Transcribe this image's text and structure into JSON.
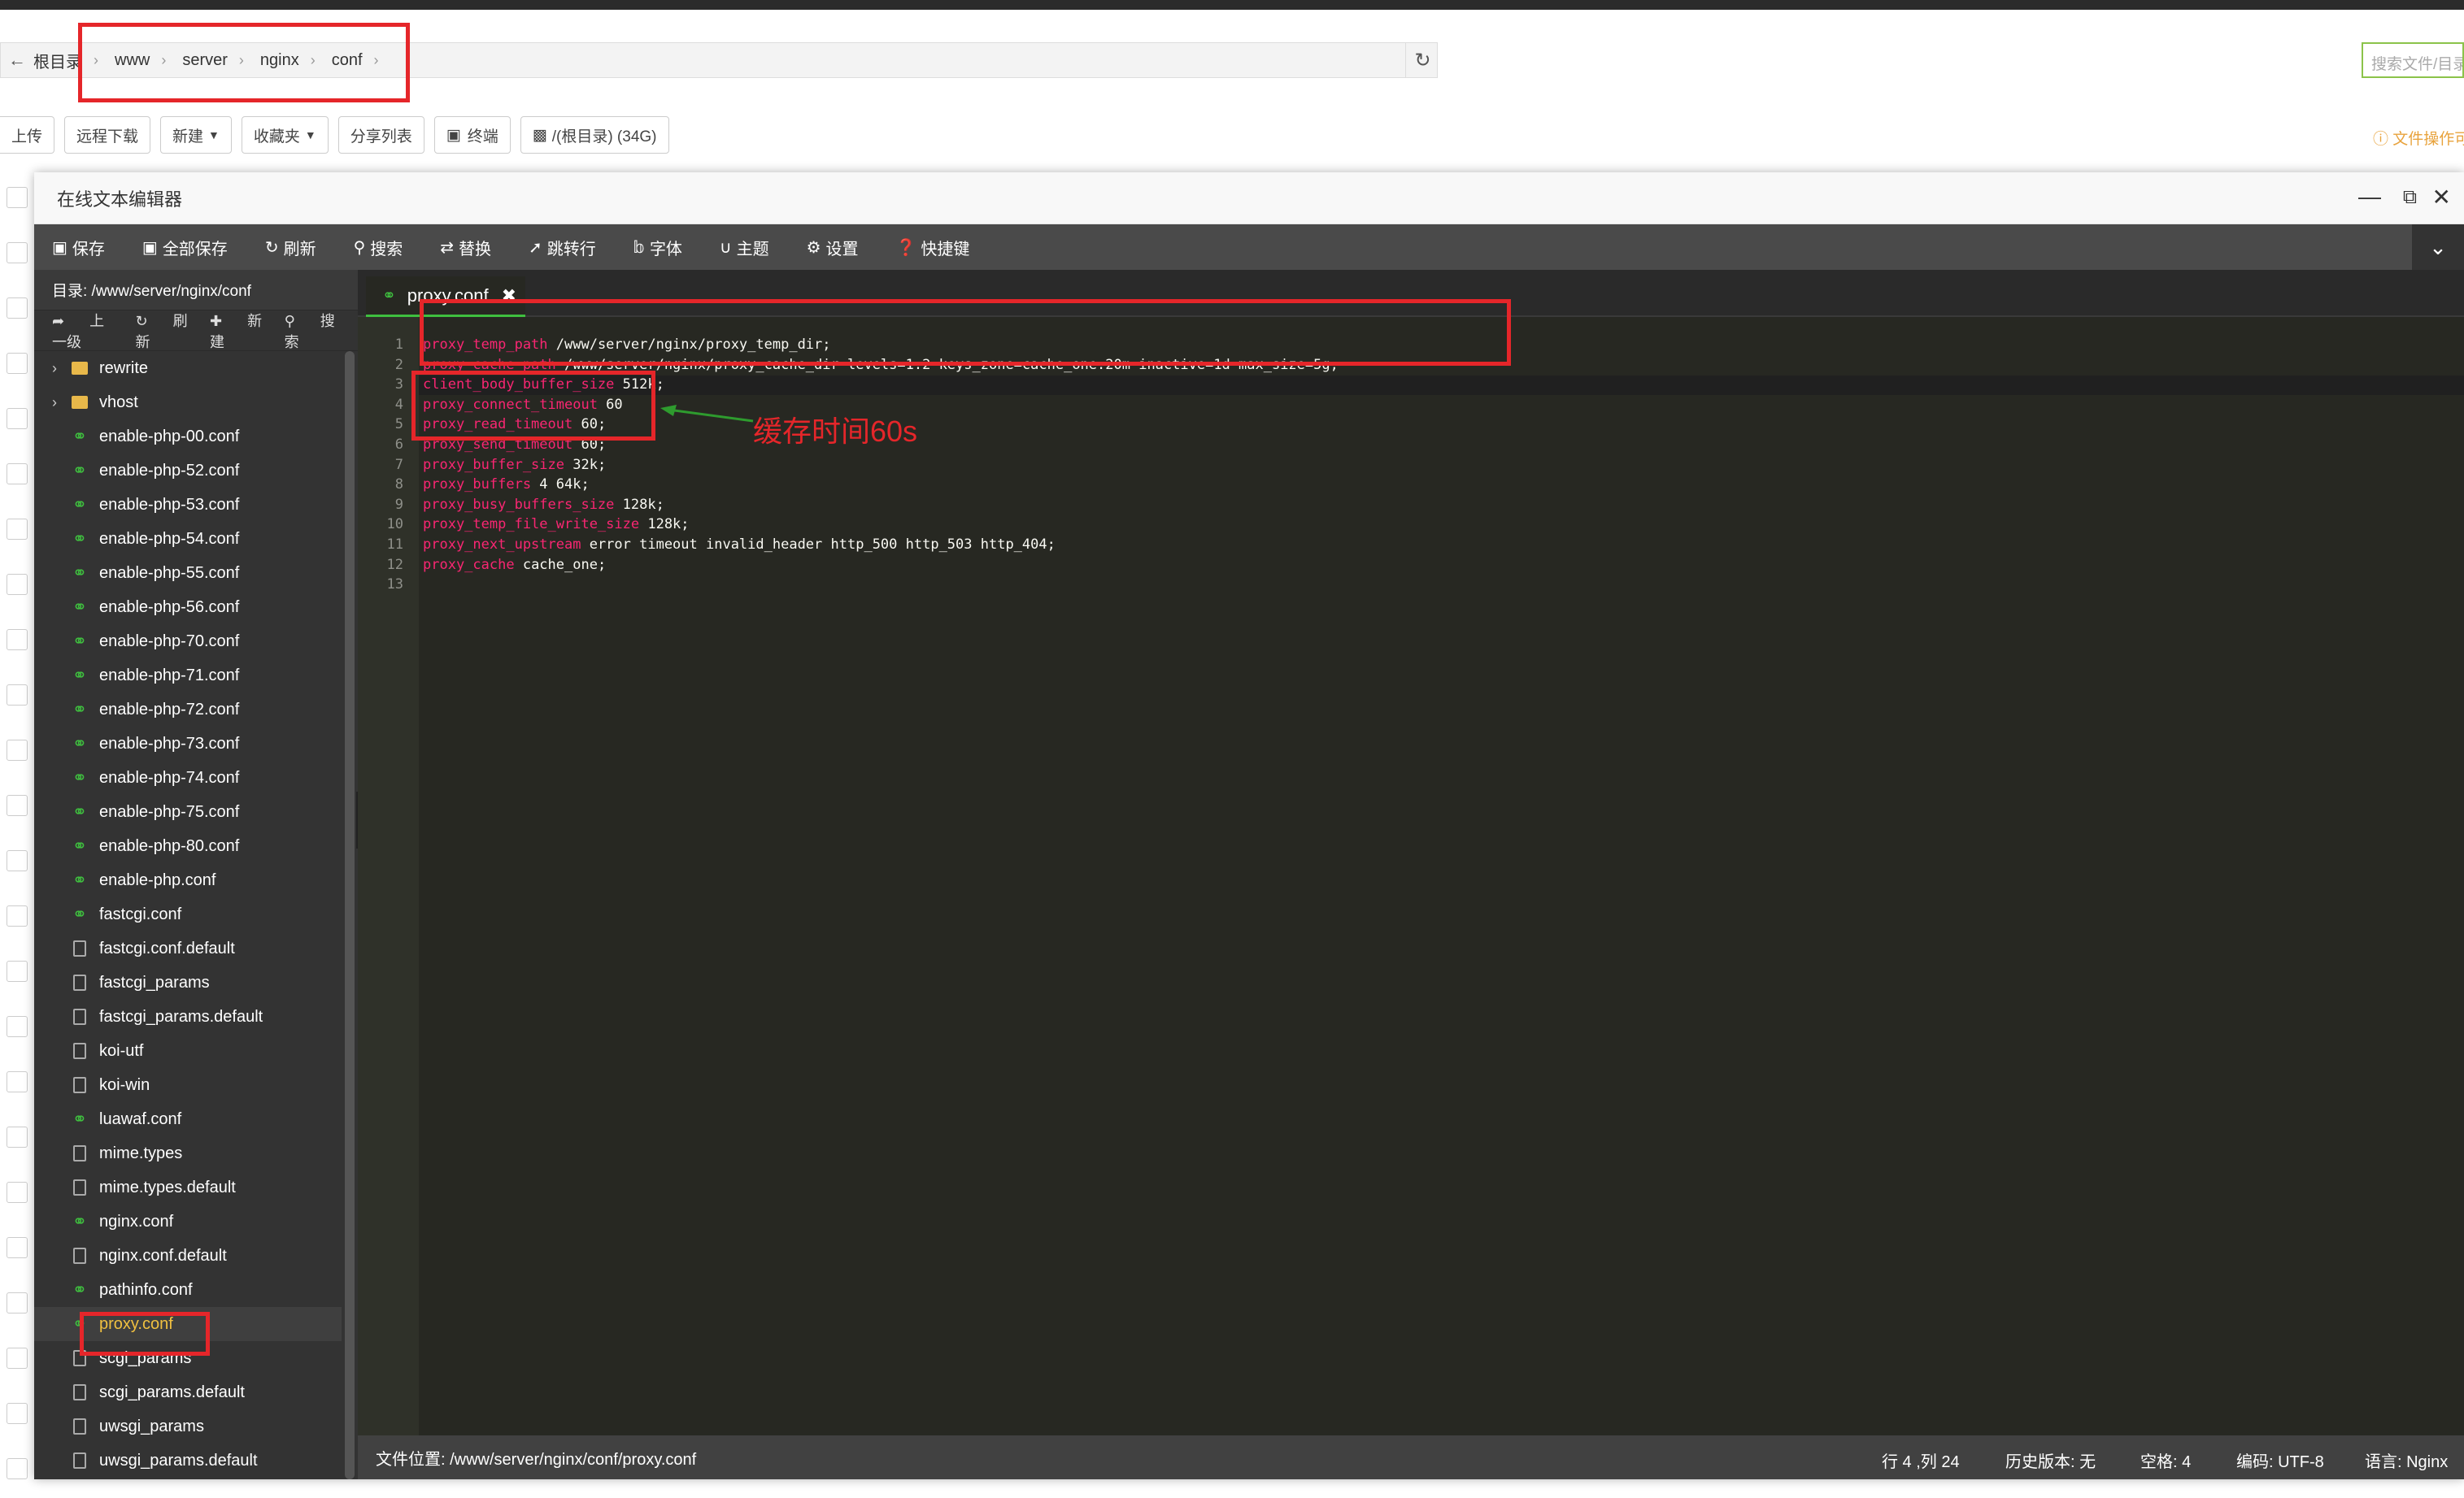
{
  "path_bar": {
    "crumbs": [
      "根目录",
      "www",
      "server",
      "nginx",
      "conf"
    ],
    "search_placeholder": "搜索文件/目录"
  },
  "toolbar": {
    "upload": "上传",
    "remote_download": "远程下载",
    "new": "新建",
    "favorites": "收藏夹",
    "share_list": "分享列表",
    "terminal": "终端",
    "disk": "/(根目录) (34G)",
    "file_ops_hint": "文件操作可"
  },
  "window": {
    "title": "在线文本编辑器"
  },
  "editor_toolbar": {
    "save": "保存",
    "save_all": "全部保存",
    "refresh": "刷新",
    "search": "搜索",
    "replace": "替换",
    "goto_line": "跳转行",
    "font": "字体",
    "theme": "主题",
    "settings": "设置",
    "shortcuts": "快捷键"
  },
  "sidebar": {
    "directory": "目录: /www/server/nginx/conf",
    "tools": {
      "up": "上一级",
      "refresh": "刷新",
      "new": "新建",
      "search": "搜索"
    },
    "items": [
      {
        "label": "rewrite",
        "type": "folder"
      },
      {
        "label": "vhost",
        "type": "folder"
      },
      {
        "label": "enable-php-00.conf",
        "type": "conf"
      },
      {
        "label": "enable-php-52.conf",
        "type": "conf"
      },
      {
        "label": "enable-php-53.conf",
        "type": "conf"
      },
      {
        "label": "enable-php-54.conf",
        "type": "conf"
      },
      {
        "label": "enable-php-55.conf",
        "type": "conf"
      },
      {
        "label": "enable-php-56.conf",
        "type": "conf"
      },
      {
        "label": "enable-php-70.conf",
        "type": "conf"
      },
      {
        "label": "enable-php-71.conf",
        "type": "conf"
      },
      {
        "label": "enable-php-72.conf",
        "type": "conf"
      },
      {
        "label": "enable-php-73.conf",
        "type": "conf"
      },
      {
        "label": "enable-php-74.conf",
        "type": "conf"
      },
      {
        "label": "enable-php-75.conf",
        "type": "conf"
      },
      {
        "label": "enable-php-80.conf",
        "type": "conf"
      },
      {
        "label": "enable-php.conf",
        "type": "conf"
      },
      {
        "label": "fastcgi.conf",
        "type": "conf"
      },
      {
        "label": "fastcgi.conf.default",
        "type": "file"
      },
      {
        "label": "fastcgi_params",
        "type": "file"
      },
      {
        "label": "fastcgi_params.default",
        "type": "file"
      },
      {
        "label": "koi-utf",
        "type": "file"
      },
      {
        "label": "koi-win",
        "type": "file"
      },
      {
        "label": "luawaf.conf",
        "type": "conf"
      },
      {
        "label": "mime.types",
        "type": "file"
      },
      {
        "label": "mime.types.default",
        "type": "file"
      },
      {
        "label": "nginx.conf",
        "type": "conf"
      },
      {
        "label": "nginx.conf.default",
        "type": "file"
      },
      {
        "label": "pathinfo.conf",
        "type": "conf"
      },
      {
        "label": "proxy.conf",
        "type": "conf",
        "selected": true
      },
      {
        "label": "scgi_params",
        "type": "file"
      },
      {
        "label": "scgi_params.default",
        "type": "file"
      },
      {
        "label": "uwsgi_params",
        "type": "file"
      },
      {
        "label": "uwsgi_params.default",
        "type": "file"
      }
    ]
  },
  "editor": {
    "tab": "proxy.conf",
    "lines": [
      {
        "n": "1",
        "key": "proxy_temp_path",
        "rest": " /www/server/nginx/proxy_temp_dir;"
      },
      {
        "n": "2",
        "key": "proxy_cache_path",
        "rest": " /www/server/nginx/proxy_cache_dir levels=1:2 keys_zone=cache_one:20m inactive=1d max_size=5g;"
      },
      {
        "n": "3",
        "key": "client_body_buffer_size",
        "rest": " 512k;"
      },
      {
        "n": "4",
        "key": "proxy_connect_timeout",
        "rest": " 60"
      },
      {
        "n": "5",
        "key": "proxy_read_timeout",
        "rest": " 60;"
      },
      {
        "n": "6",
        "key": "proxy_send_timeout",
        "rest": " 60;"
      },
      {
        "n": "7",
        "key": "proxy_buffer_size",
        "rest": " 32k;"
      },
      {
        "n": "8",
        "key": "proxy_buffers",
        "rest": " 4 64k;"
      },
      {
        "n": "9",
        "key": "proxy_busy_buffers_size",
        "rest": " 128k;"
      },
      {
        "n": "10",
        "key": "proxy_temp_file_write_size",
        "rest": " 128k;"
      },
      {
        "n": "11",
        "key": "proxy_next_upstream",
        "rest": " error timeout invalid_header http_500 http_503 http_404;"
      },
      {
        "n": "12",
        "key": "proxy_cache",
        "rest": " cache_one;"
      },
      {
        "n": "13",
        "key": "",
        "rest": ""
      }
    ],
    "annotation": "缓存时间60s"
  },
  "statusbar": {
    "file_location": "文件位置: /www/server/nginx/conf/proxy.conf",
    "cursor": "行 4 ,列 24",
    "history": "历史版本: 无",
    "spaces": "空格: 4",
    "encoding": "编码: UTF-8",
    "language": "语言: Nginx"
  },
  "colors": {
    "annotation_red": "#e5262a",
    "conf_icon_green": "#3fbf3f",
    "keyword_pink": "#f92672",
    "editor_bg": "#272822"
  }
}
